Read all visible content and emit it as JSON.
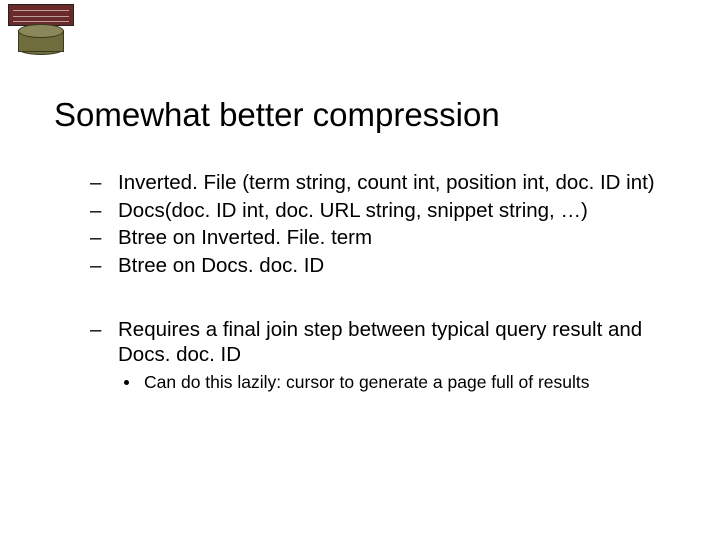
{
  "title": "Somewhat better compression",
  "group1": {
    "item1": "Inverted. File (term string, count int, position int, doc. ID int)",
    "item2": "Docs(doc. ID int, doc. URL string, snippet string, …)",
    "item3": "Btree on Inverted. File. term",
    "item4": "Btree on Docs. doc. ID"
  },
  "group2": {
    "item1": "Requires a final join step between typical query result and Docs. doc. ID",
    "sub1": "Can do this lazily: cursor to generate a page full of results"
  }
}
